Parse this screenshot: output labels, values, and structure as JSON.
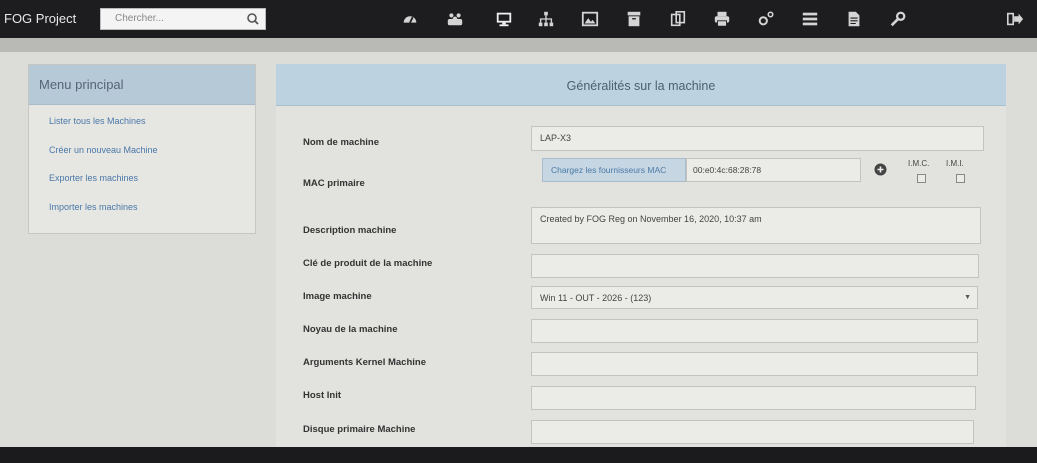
{
  "app": {
    "brand": "FOG Project"
  },
  "search": {
    "placeholder": "Chercher..."
  },
  "sidebar": {
    "title": "Menu principal",
    "items": [
      {
        "label": "Lister tous les Machines"
      },
      {
        "label": "Créer un nouveau Machine"
      },
      {
        "label": "Exporter les machines"
      },
      {
        "label": "Importer les machines"
      }
    ]
  },
  "panel": {
    "title": "Généralités sur la machine",
    "fields": {
      "hostname": {
        "label": "Nom de machine",
        "value": "LAP-X3"
      },
      "mac": {
        "label": "MAC primaire",
        "vendor_button": "Chargez les fournisseurs MAC",
        "value": "00:e0:4c:68:28:78",
        "imc_label": "I.M.C.",
        "imi_label": "I.M.I."
      },
      "description": {
        "label": "Description machine",
        "value": "Created by FOG Reg on November 16, 2020, 10:37 am"
      },
      "product_key": {
        "label": "Clé de produit de la machine",
        "value": ""
      },
      "image": {
        "label": "Image machine",
        "value": "Win 11 - OUT - 2026 - (123)"
      },
      "kernel": {
        "label": "Noyau de la machine",
        "value": ""
      },
      "kernel_args": {
        "label": "Arguments Kernel Machine",
        "value": ""
      },
      "host_init": {
        "label": "Host Init",
        "value": ""
      },
      "primary_disk": {
        "label": "Disque primaire Machine",
        "value": ""
      }
    }
  },
  "icons": {
    "nav": [
      "dashboard-icon",
      "users-icon",
      "hosts-icon",
      "groups-icon",
      "images-icon",
      "storage-icon",
      "snapins-icon",
      "printers-icon",
      "service-config-icon",
      "tasks-icon",
      "reports-icon",
      "fog-config-icon"
    ],
    "logout": "logout-icon",
    "search": "search-icon",
    "plus": "plus-icon"
  },
  "colors": {
    "topbar": "#1d1d1f",
    "header_blue": "#bcd2e0",
    "link_blue": "#4a78a8"
  }
}
